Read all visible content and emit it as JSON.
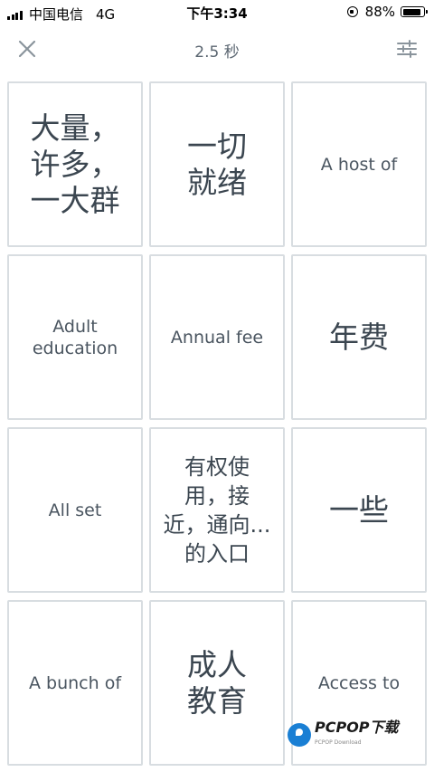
{
  "status_bar": {
    "carrier": "中国电信",
    "network": "4G",
    "time": "下午3:34",
    "battery_text": "88%",
    "battery_level": 0.88
  },
  "header": {
    "close_icon": "close-icon",
    "timer": "2.5 秒",
    "settings_icon": "sliders-icon"
  },
  "tiles": [
    {
      "text": "大量，\n许多，\n一大群",
      "lang": "zh-l"
    },
    {
      "text": "一切\n就绪",
      "lang": "zh-l"
    },
    {
      "text": "A host of",
      "lang": "en"
    },
    {
      "text": "Adult\neducation",
      "lang": "en"
    },
    {
      "text": "Annual fee",
      "lang": "en"
    },
    {
      "text": "年费",
      "lang": "zh-l"
    },
    {
      "text": "All set",
      "lang": "en"
    },
    {
      "text": "有权使\n用，接\n近，通向...\n的入口",
      "lang": "zh-m"
    },
    {
      "text": "一些",
      "lang": "zh-l"
    },
    {
      "text": "A bunch of",
      "lang": "en"
    },
    {
      "text": "成人\n教育",
      "lang": "zh-l"
    },
    {
      "text": "Access to",
      "lang": "en"
    }
  ],
  "watermark": {
    "title": "PCPOP下载",
    "subtitle": "PCPOP Download"
  },
  "colors": {
    "tile_border": "#d8dde1",
    "text": "#3b4650",
    "icon": "#8a949c"
  }
}
